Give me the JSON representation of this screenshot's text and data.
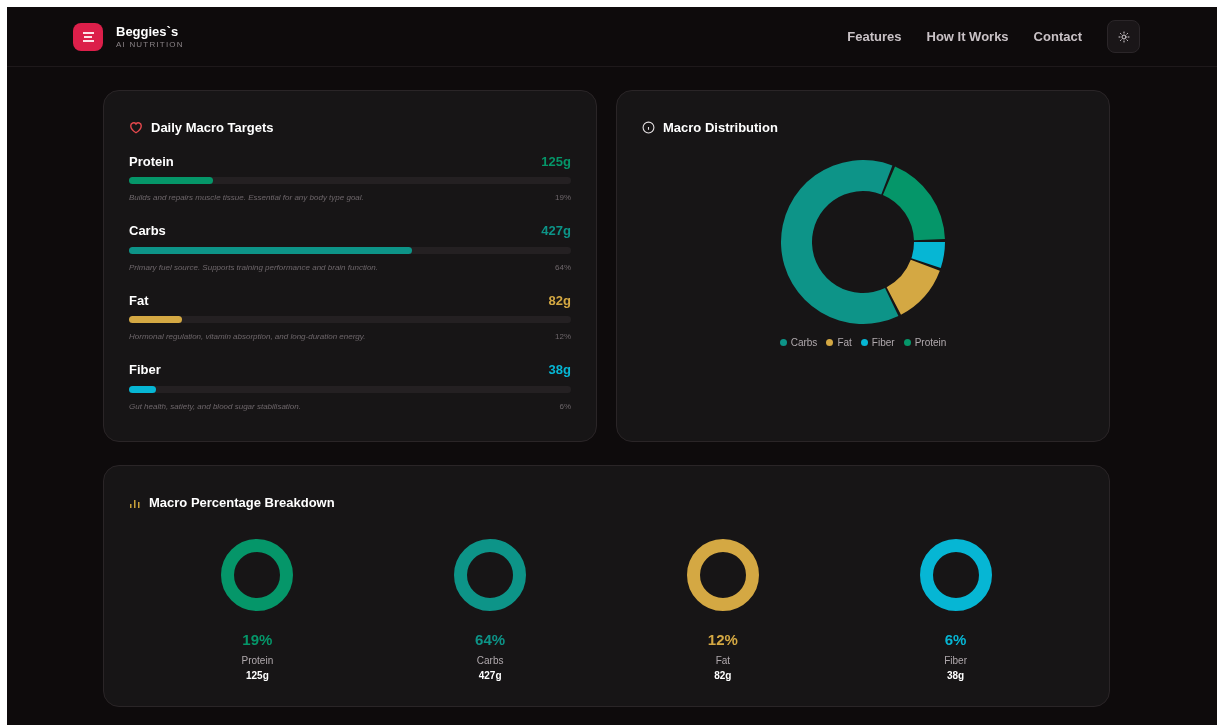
{
  "brand": {
    "name": "Beggies`s",
    "tagline": "AI NUTRITION"
  },
  "nav": [
    {
      "label": "Features"
    },
    {
      "label": "How It Works"
    },
    {
      "label": "Contact"
    }
  ],
  "targets": {
    "title": "Daily Macro Targets",
    "items": [
      {
        "name": "Protein",
        "amount": "125g",
        "level": 0.19,
        "description": "Builds and repairs muscle tissue. Essential for any body type goal.",
        "percent": "19%",
        "color": "#059669"
      },
      {
        "name": "Carbs",
        "amount": "427g",
        "level": 0.64,
        "description": "Primary fuel source. Supports training performance and brain function.",
        "percent": "64%",
        "color": "#0d9488"
      },
      {
        "name": "Fat",
        "amount": "82g",
        "level": 0.12,
        "description": "Hormonal regulation, vitamin absorption, and long-duration energy.",
        "percent": "12%",
        "color": "#d4a843"
      },
      {
        "name": "Fiber",
        "amount": "38g",
        "level": 0.06,
        "description": "Gut health, satiety, and blood sugar stabilisation.",
        "percent": "6%",
        "color": "#06b6d4"
      }
    ]
  },
  "distribution": {
    "title": "Macro Distribution",
    "chart_data": {
      "type": "donut",
      "values": [
        63.5,
        12.2,
        5.7,
        18.6
      ]
    },
    "legend": [
      {
        "label": "Carbs",
        "color": "#0d9488"
      },
      {
        "label": "Fat",
        "color": "#d4a843"
      },
      {
        "label": "Fiber",
        "color": "#06b6d4"
      },
      {
        "label": "Protein",
        "color": "#059669"
      }
    ]
  },
  "breakdown": {
    "title": "Macro Percentage Breakdown",
    "items": [
      {
        "percent": "19%",
        "name": "Protein",
        "amount": "125g",
        "color": "#059669"
      },
      {
        "percent": "64%",
        "name": "Carbs",
        "amount": "427g",
        "color": "#0d9488"
      },
      {
        "percent": "12%",
        "name": "Fat",
        "amount": "82g",
        "color": "#d4a843"
      },
      {
        "percent": "6%",
        "name": "Fiber",
        "amount": "38g",
        "color": "#06b6d4"
      }
    ]
  }
}
